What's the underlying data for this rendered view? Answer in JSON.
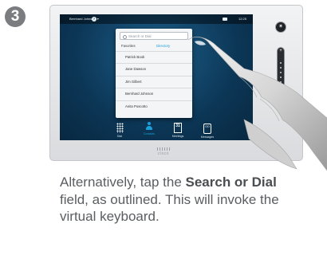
{
  "step": {
    "number": "3"
  },
  "device": {
    "statusbar": {
      "user": "Bernhard Johnson",
      "user_caret": "▾",
      "help": "?",
      "time": "12:25"
    },
    "search": {
      "placeholder": "Search or Dial"
    },
    "tabs": {
      "favorites": "Favorites",
      "directory": "Directory"
    },
    "contacts": [
      "Patrick Book",
      "Jane Dawson",
      "Jim Gilbert",
      "Bernhard Johnson",
      "Anita Poscotto"
    ],
    "taskbar": {
      "dial": "Dial",
      "contacts": "Contacts",
      "meetings": "Meetings",
      "meetings_day": "31",
      "messages": "Messages",
      "messages_glyph": "OO"
    },
    "volume": {
      "plus": "+",
      "minus": "−"
    },
    "brand": "cisco",
    "colors": {
      "accent": "#1aa0d8",
      "screen": "#0c3656",
      "bezel": "#e4e6e8"
    },
    "icons": [
      "search-icon",
      "help-icon",
      "camera-icon",
      "mic-icon",
      "dial-grid-icon",
      "person-icon",
      "calendar-icon",
      "messages-icon"
    ]
  },
  "caption": {
    "pre": "Alternatively, tap the ",
    "bold": "Search or Dial",
    "post": " field, as outlined. This will invoke the virtual keyboard."
  }
}
